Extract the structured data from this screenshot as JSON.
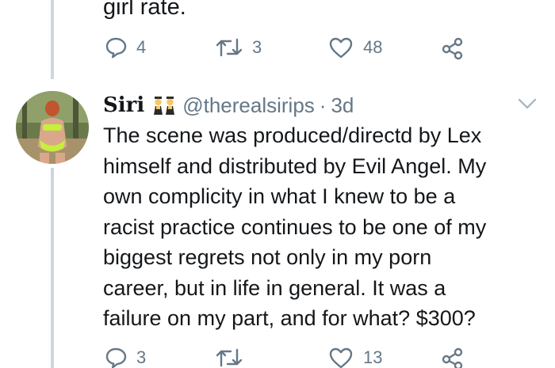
{
  "previous_tweet": {
    "text_tail": "girl rate.",
    "stats": {
      "replies": "4",
      "retweets": "3",
      "likes": "48"
    }
  },
  "tweet": {
    "display_name": "Siri",
    "emoji": "twins-emoji",
    "handle": "@therealsirips",
    "separator": "·",
    "time": "3d",
    "lines": [
      "The scene was produced/directd by Lex",
      "himself and distributed by Evil Angel. My",
      "own complicity in what I knew to be a",
      "racist practice continues to be one of my",
      "biggest regrets not only in my porn",
      "career, but in life in general. It was a",
      "failure on my part, and for what? $300?"
    ],
    "stats": {
      "replies": "3",
      "retweets": "",
      "likes": "13"
    }
  },
  "icons": [
    "reply-icon",
    "retweet-icon",
    "like-icon",
    "share-icon",
    "caret-down-icon"
  ],
  "colors": {
    "text": "#14171a",
    "muted": "#657786",
    "thread_line": "#ccd6dd"
  }
}
